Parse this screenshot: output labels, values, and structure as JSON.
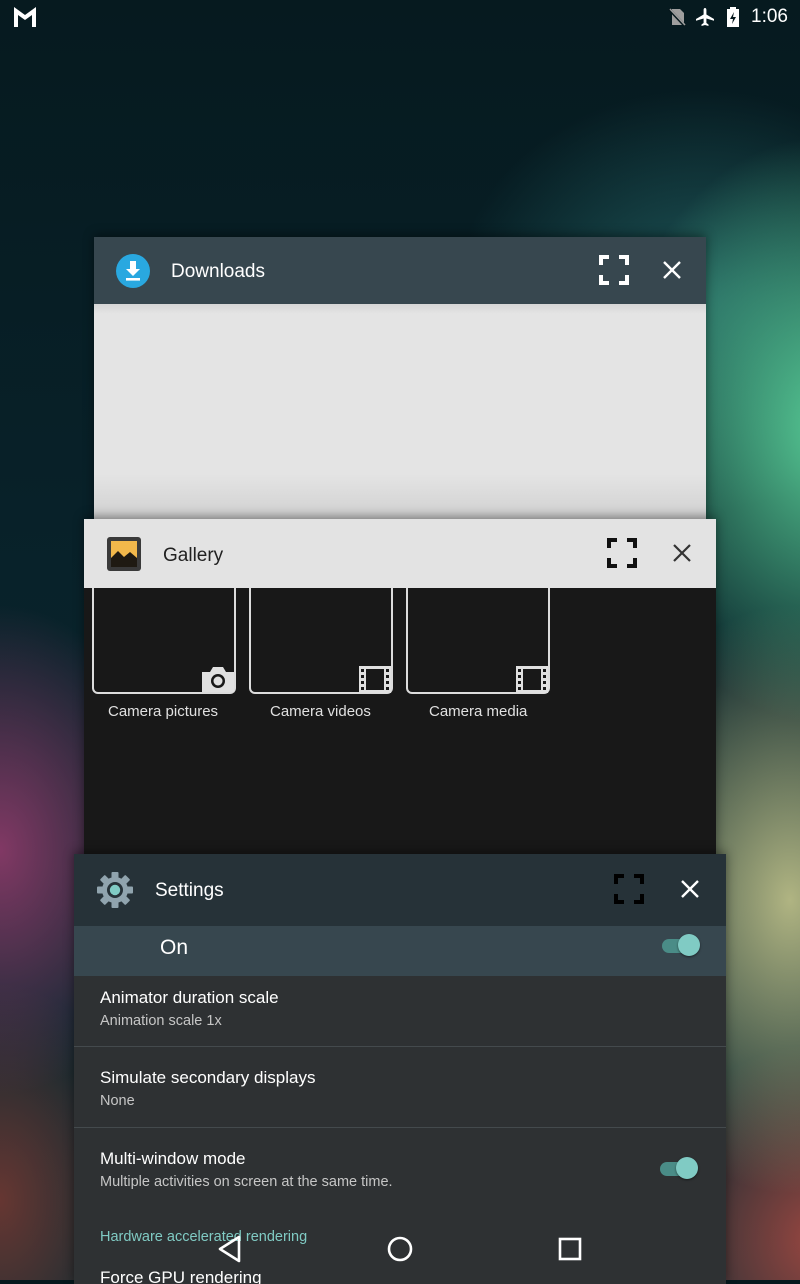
{
  "status_bar": {
    "notification_icon": "gmail-m-icon",
    "icons": [
      "no-sim-icon",
      "airplane-mode-icon",
      "battery-charging-icon"
    ],
    "time": "1:06"
  },
  "recents": [
    {
      "id": "downloads",
      "title": "Downloads",
      "icon": "download-icon",
      "bar_color": "#37474f"
    },
    {
      "id": "gallery",
      "title": "Gallery",
      "icon": "gallery-icon",
      "bar_color": "#e3e3e3",
      "albums": [
        {
          "label": "Camera pictures",
          "icon": "camera-icon"
        },
        {
          "label": "Camera videos",
          "icon": "film-icon"
        },
        {
          "label": "Camera media",
          "icon": "film-icon"
        }
      ]
    },
    {
      "id": "settings",
      "title": "Settings",
      "icon": "settings-gear-icon",
      "bar_color": "#263238",
      "master_switch": {
        "label": "On",
        "checked": true
      },
      "prefs": [
        {
          "title": "Animator duration scale",
          "summary": "Animation scale 1x"
        },
        {
          "title": "Simulate secondary displays",
          "summary": "None"
        },
        {
          "title": "Multi-window mode",
          "summary": "Multiple activities on screen at the same time.",
          "toggle": true
        }
      ],
      "category": "Hardware accelerated rendering",
      "partial_item": "Force GPU rendering"
    }
  ],
  "navigation": {
    "buttons": [
      "back-icon",
      "home-icon",
      "recents-icon"
    ]
  },
  "colors": {
    "accent": "#80cbc4"
  }
}
